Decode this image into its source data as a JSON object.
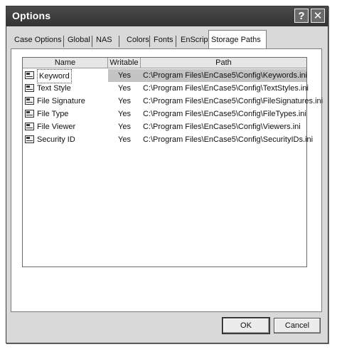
{
  "window": {
    "title": "Options"
  },
  "tabs": [
    {
      "label": "Case Options"
    },
    {
      "label": "Global"
    },
    {
      "label": "NAS"
    },
    {
      "label": "Colors"
    },
    {
      "label": "Fonts"
    },
    {
      "label": "EnScript"
    },
    {
      "label": "Storage Paths",
      "active": true
    }
  ],
  "list": {
    "columns": [
      "Name",
      "Writable",
      "Path"
    ],
    "rows": [
      {
        "name": "Keyword",
        "writable": "Yes",
        "path": "C:\\Program Files\\EnCase5\\Config\\Keywords.ini",
        "selected": true
      },
      {
        "name": "Text Style",
        "writable": "Yes",
        "path": "C:\\Program Files\\EnCase5\\Config\\TextStyles.ini"
      },
      {
        "name": "File Signature",
        "writable": "Yes",
        "path": "C:\\Program Files\\EnCase5\\Config\\FileSignatures.ini"
      },
      {
        "name": "File Type",
        "writable": "Yes",
        "path": "C:\\Program Files\\EnCase5\\Config\\FileTypes.ini"
      },
      {
        "name": "File Viewer",
        "writable": "Yes",
        "path": "C:\\Program Files\\EnCase5\\Config\\Viewers.ini"
      },
      {
        "name": "Security ID",
        "writable": "Yes",
        "path": "C:\\Program Files\\EnCase5\\Config\\SecurityIDs.ini"
      }
    ]
  },
  "buttons": {
    "ok": "OK",
    "cancel": "Cancel"
  },
  "icons": {
    "help": "help-icon",
    "close": "close-icon",
    "row": "config-file-icon"
  }
}
